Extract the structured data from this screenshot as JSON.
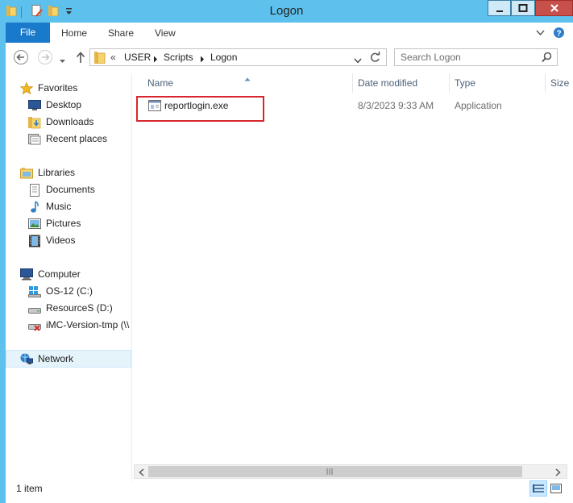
{
  "window": {
    "title": "Logon"
  },
  "ribbon": {
    "tabs": [
      {
        "label": "File"
      },
      {
        "label": "Home"
      },
      {
        "label": "Share"
      },
      {
        "label": "View"
      }
    ]
  },
  "address": {
    "overflow": "«",
    "crumbs": [
      "USER",
      "Scripts",
      "Logon"
    ]
  },
  "search": {
    "placeholder": "Search Logon"
  },
  "sidebar": {
    "favorites": {
      "label": "Favorites",
      "items": [
        {
          "label": "Desktop",
          "icon": "desktop-icon"
        },
        {
          "label": "Downloads",
          "icon": "downloads-folder-icon"
        },
        {
          "label": "Recent places",
          "icon": "recent-places-icon"
        }
      ]
    },
    "libraries": {
      "label": "Libraries",
      "items": [
        {
          "label": "Documents",
          "icon": "documents-icon"
        },
        {
          "label": "Music",
          "icon": "music-icon"
        },
        {
          "label": "Pictures",
          "icon": "pictures-icon"
        },
        {
          "label": "Videos",
          "icon": "videos-icon"
        }
      ]
    },
    "computer": {
      "label": "Computer",
      "items": [
        {
          "label": "OS-12 (C:)",
          "icon": "windows-drive-icon"
        },
        {
          "label": "ResourceS (D:)",
          "icon": "drive-icon"
        },
        {
          "label": "iMC-Version-tmp (\\\\",
          "icon": "disconnected-network-drive-icon"
        }
      ]
    },
    "network": {
      "label": "Network"
    }
  },
  "file_list": {
    "columns": [
      {
        "label": "Name"
      },
      {
        "label": "Date modified"
      },
      {
        "label": "Type"
      },
      {
        "label": "Size"
      }
    ],
    "rows": [
      {
        "name": "reportlogin.exe",
        "date_modified": "8/3/2023 9:33 AM",
        "type": "Application",
        "icon": "application-exe-icon",
        "highlight_color": "#d9262e"
      }
    ]
  },
  "status": {
    "item_count": "1 item"
  },
  "colors": {
    "title_bar": "#5ec0ec",
    "file_tab": "#1979ca",
    "close_button": "#c7504a",
    "selection_highlight": "#e5f3fb",
    "annotation_box": "#d9262e"
  }
}
